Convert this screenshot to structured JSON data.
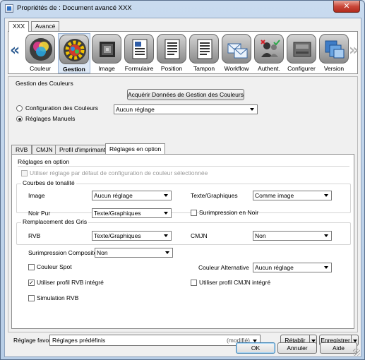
{
  "window": {
    "title": "Propriétés de : Document avancé XXX",
    "close_glyph": "✕"
  },
  "top_tabs": [
    {
      "label": "XXX",
      "active": true
    },
    {
      "label": "Avancé",
      "active": false
    }
  ],
  "toolbar": {
    "prev_arrow": "«",
    "next_arrow": "»",
    "items": [
      {
        "label": "Couleur",
        "icon": "color-circles-icon",
        "selected": false
      },
      {
        "label": "Gestion",
        "icon": "color-gear-icon",
        "selected": true
      },
      {
        "label": "Image",
        "icon": "image-pattern-icon",
        "selected": false
      },
      {
        "label": "Formulaire",
        "icon": "form-document-icon",
        "selected": false
      },
      {
        "label": "Position",
        "icon": "position-document-icon",
        "selected": false
      },
      {
        "label": "Tampon",
        "icon": "stamp-icon",
        "selected": false
      },
      {
        "label": "Workflow",
        "icon": "workflow-envelopes-icon",
        "selected": false
      },
      {
        "label": "Authent.",
        "icon": "authentication-users-icon",
        "selected": false
      },
      {
        "label": "Configurer",
        "icon": "printer-config-icon",
        "selected": false
      },
      {
        "label": "Version",
        "icon": "version-windows-icon",
        "selected": false
      }
    ]
  },
  "panel": {
    "title": "Gestion des Couleurs",
    "acquire_button": "Acquérir Données de Gestion des Couleurs",
    "radio_config": {
      "label": "Configuration des Couleurs",
      "checked": false
    },
    "config_select": "Aucun réglage",
    "radio_manual": {
      "label": "Réglages Manuels",
      "checked": true
    },
    "inner_tabs": [
      {
        "label": "RVB",
        "active": false
      },
      {
        "label": "CMJN",
        "active": false
      },
      {
        "label": "Profil d'imprimante",
        "active": false
      },
      {
        "label": "Réglages en option",
        "active": true
      }
    ],
    "options": {
      "section_title": "Réglages en option",
      "use_default_label": "Utiliser réglage par défaut de configuration de couleur sélectionnée",
      "tone_curves": {
        "title": "Courbes de tonalité",
        "image_label": "Image",
        "image_value": "Aucun réglage",
        "text_graphics_label": "Texte/Graphiques",
        "text_graphics_value": "Comme image"
      },
      "pure_black_label": "Noir Pur",
      "pure_black_value": "Texte/Graphiques",
      "overprint_black_label": "Surimpression en Noir",
      "gray_replacement": {
        "title": "Remplacement des Gris",
        "rvb_label": "RVB",
        "rvb_value": "Texte/Graphiques",
        "cmjn_label": "CMJN",
        "cmjn_value": "Non"
      },
      "composite_overprint_label": "Surimpression Composite",
      "composite_overprint_value": "Non",
      "spot_color_label": "Couleur Spot",
      "alt_color_label": "Couleur Alternative",
      "alt_color_value": "Aucun réglage",
      "use_rvb_profile_label": "Utiliser profil RVB intégré",
      "use_rvb_profile_checked": true,
      "use_cmjn_profile_label": "Utiliser profil CMJN intégré",
      "rvb_simulation_label": "Simulation RVB",
      "check_glyph": "✓"
    }
  },
  "favorites": {
    "label": "Réglage favori",
    "value": "Réglages prédéfinis",
    "modified": "(modifié)",
    "restore_button": "Rétablir",
    "save_button": "Enregistrer"
  },
  "dialog_buttons": {
    "ok": "OK",
    "cancel": "Annuler",
    "help": "Aide"
  }
}
